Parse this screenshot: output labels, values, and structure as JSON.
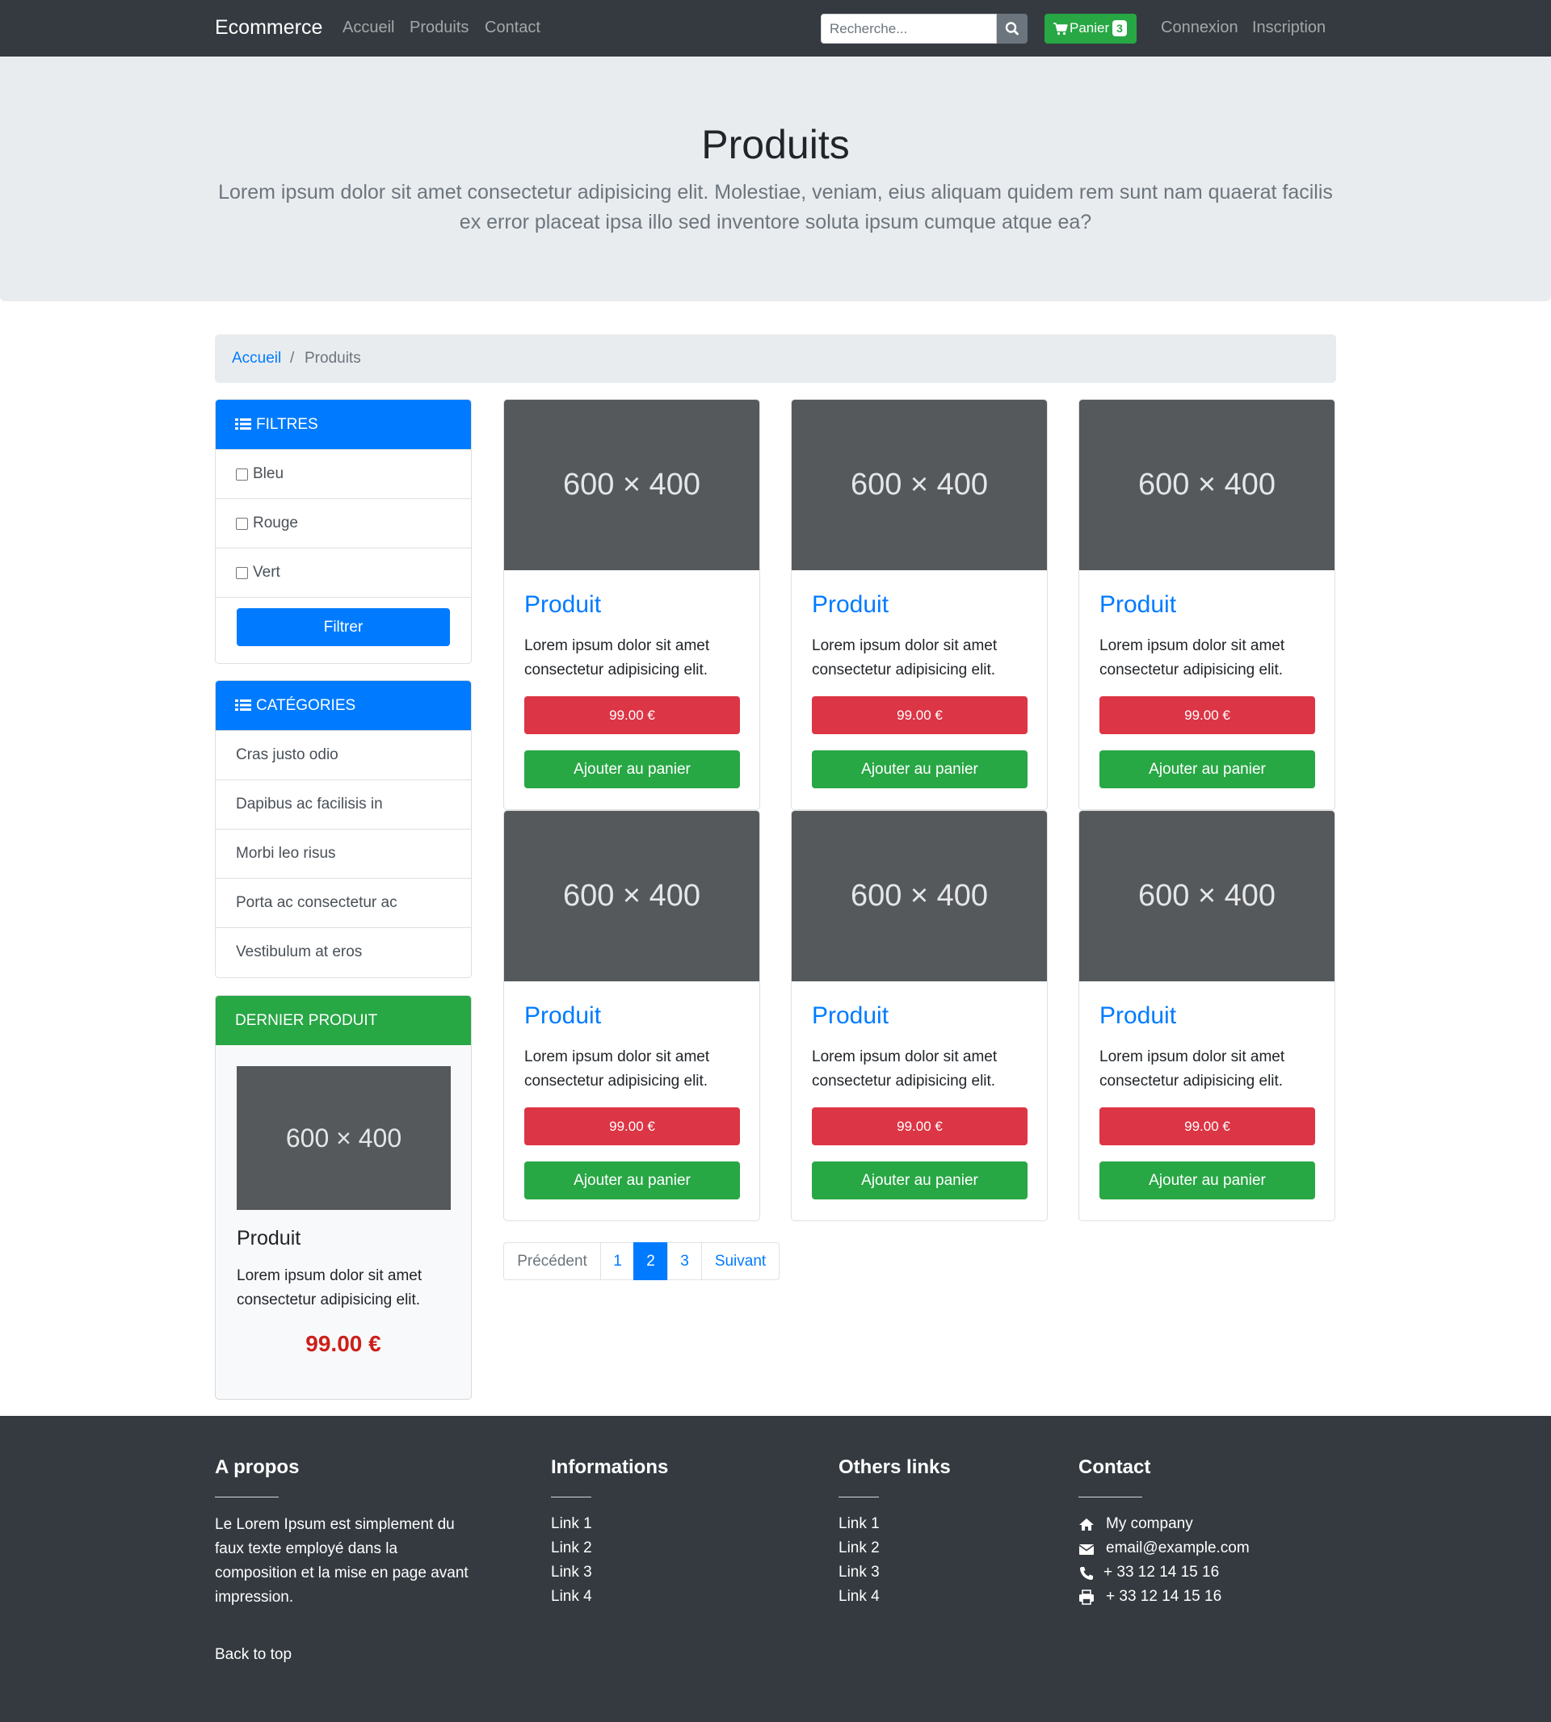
{
  "navbar": {
    "brand": "Ecommerce",
    "links": [
      "Accueil",
      "Produits",
      "Contact"
    ],
    "search_placeholder": "Recherche...",
    "cart_label": "Panier",
    "cart_count": "3",
    "auth_links": [
      "Connexion",
      "Inscription"
    ]
  },
  "jumbotron": {
    "title": "Produits",
    "lead": "Lorem ipsum dolor sit amet consectetur adipisicing elit. Molestiae, veniam, eius aliquam quidem rem sunt nam quaerat facilis ex error placeat ipsa illo sed inventore soluta ipsum cumque atque ea?"
  },
  "breadcrumb": {
    "home": "Accueil",
    "separator": "/",
    "current": "Produits"
  },
  "filters": {
    "title": "FILTRES",
    "options": [
      "Bleu",
      "Rouge",
      "Vert"
    ],
    "button": "Filtrer"
  },
  "categories": {
    "title": "CATÉGORIES",
    "items": [
      "Cras justo odio",
      "Dapibus ac facilisis in",
      "Morbi leo risus",
      "Porta ac consectetur ac",
      "Vestibulum at eros"
    ]
  },
  "latest": {
    "title": "DERNIER PRODUIT",
    "image_label": "600 × 400",
    "name": "Produit",
    "description": "Lorem ipsum dolor sit amet consectetur adipisicing elit.",
    "price": "99.00 €"
  },
  "products": [
    {
      "image_label": "600 × 400",
      "name": "Produit",
      "description": "Lorem ipsum dolor sit amet consectetur adipisicing elit.",
      "price": "99.00 €",
      "add_label": "Ajouter au panier"
    },
    {
      "image_label": "600 × 400",
      "name": "Produit",
      "description": "Lorem ipsum dolor sit amet consectetur adipisicing elit.",
      "price": "99.00 €",
      "add_label": "Ajouter au panier"
    },
    {
      "image_label": "600 × 400",
      "name": "Produit",
      "description": "Lorem ipsum dolor sit amet consectetur adipisicing elit.",
      "price": "99.00 €",
      "add_label": "Ajouter au panier"
    },
    {
      "image_label": "600 × 400",
      "name": "Produit",
      "description": "Lorem ipsum dolor sit amet consectetur adipisicing elit.",
      "price": "99.00 €",
      "add_label": "Ajouter au panier"
    },
    {
      "image_label": "600 × 400",
      "name": "Produit",
      "description": "Lorem ipsum dolor sit amet consectetur adipisicing elit.",
      "price": "99.00 €",
      "add_label": "Ajouter au panier"
    },
    {
      "image_label": "600 × 400",
      "name": "Produit",
      "description": "Lorem ipsum dolor sit amet consectetur adipisicing elit.",
      "price": "99.00 €",
      "add_label": "Ajouter au panier"
    }
  ],
  "pagination": {
    "previous": "Précédent",
    "pages": [
      "1",
      "2",
      "3"
    ],
    "active_page": "2",
    "next": "Suivant"
  },
  "footer": {
    "about": {
      "title": "A propos",
      "text": "Le Lorem Ipsum est simplement du faux texte employé dans la composition et la mise en page avant impression.",
      "back_to_top": "Back to top"
    },
    "informations": {
      "title": "Informations",
      "links": [
        "Link 1",
        "Link 2",
        "Link 3",
        "Link 4"
      ]
    },
    "others": {
      "title": "Others links",
      "links": [
        "Link 1",
        "Link 2",
        "Link 3",
        "Link 4"
      ]
    },
    "contact": {
      "title": "Contact",
      "company": "My company",
      "email": "email@example.com",
      "phone": "+ 33 12 14 15 16",
      "fax": "+ 33 12 14 15 16"
    }
  },
  "colors": {
    "navbar_bg": "#343a40",
    "primary": "#007bff",
    "success": "#28a745",
    "danger": "#dc3545",
    "jumbotron_bg": "#e9ecef",
    "placeholder_bg": "#55595c",
    "latest_price": "#cc1f1a"
  },
  "icons": {
    "search": "search-icon",
    "cart": "shopping-cart-icon",
    "list": "list-icon",
    "home": "home-icon",
    "envelope": "envelope-icon",
    "phone": "phone-icon",
    "print": "print-icon"
  }
}
